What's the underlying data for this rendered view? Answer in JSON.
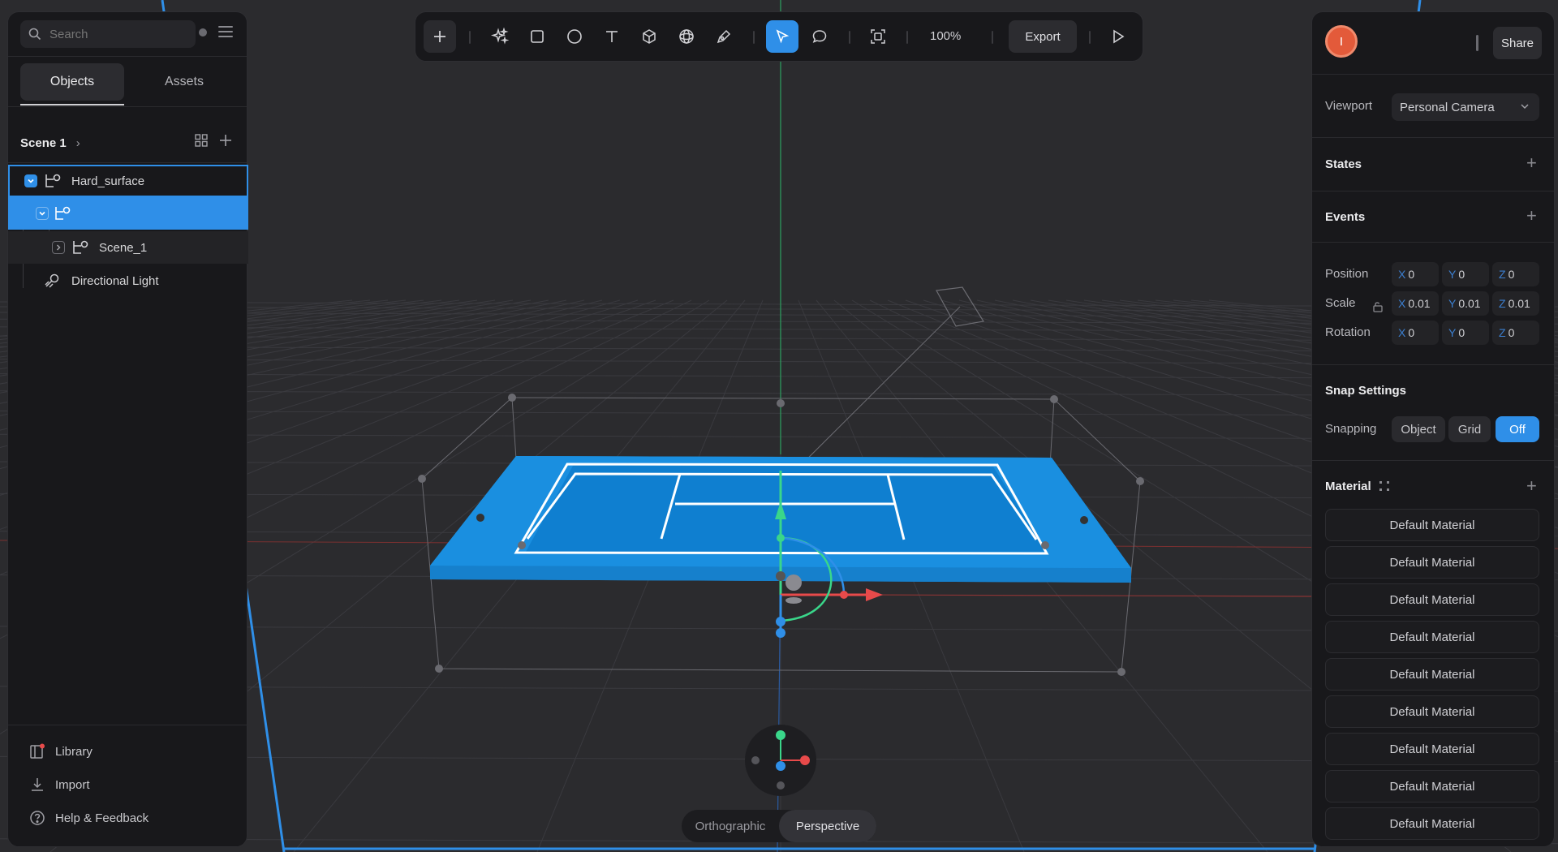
{
  "search": {
    "placeholder": "Search"
  },
  "tabs": [
    {
      "label": "Objects",
      "active": true
    },
    {
      "label": "Assets",
      "active": false
    }
  ],
  "scene": {
    "name": "Scene 1"
  },
  "tree": [
    {
      "label": "Hard_surface"
    },
    {
      "label": ""
    },
    {
      "label": "Scene_1"
    },
    {
      "label": "Directional Light"
    }
  ],
  "bottom_links": {
    "library": "Library",
    "import": "Import",
    "help": "Help & Feedback"
  },
  "toolbar": {
    "zoom": "100%",
    "export_label": "Export"
  },
  "right": {
    "avatar_initial": "I",
    "share_label": "Share",
    "viewport_label": "Viewport",
    "viewport_value": "Personal Camera",
    "states_title": "States",
    "events_title": "Events",
    "position_label": "Position",
    "scale_label": "Scale",
    "rotation_label": "Rotation",
    "position": {
      "x": "0",
      "y": "0",
      "z": "0"
    },
    "scale": {
      "x": "0.01",
      "y": "0.01",
      "z": "0.01"
    },
    "rotation": {
      "x": "0",
      "y": "0",
      "z": "0"
    },
    "snap_title": "Snap Settings",
    "snapping_label": "Snapping",
    "snap_options": [
      "Object",
      "Grid",
      "Off"
    ],
    "snap_selected": "Off",
    "material_title": "Material",
    "materials": [
      "Default Material",
      "Default Material",
      "Default Material",
      "Default Material",
      "Default Material",
      "Default Material",
      "Default Material",
      "Default Material",
      "Default Material"
    ]
  },
  "axis_letters": {
    "x": "X",
    "y": "Y",
    "z": "Z"
  },
  "view_modes": {
    "orthographic": "Orthographic",
    "perspective": "Perspective",
    "active": "Perspective"
  },
  "colors": {
    "accent": "#2f8fe8",
    "court": "#1a8fe0",
    "axis_x": "#e84a4a",
    "axis_y": "#3ad68a",
    "axis_z": "#2f8fe8"
  }
}
